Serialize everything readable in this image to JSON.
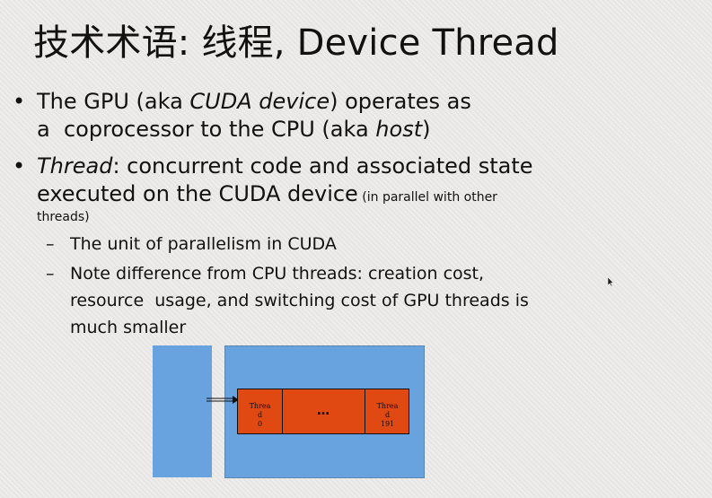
{
  "slide": {
    "title": "技术术语: 线程, Device Thread",
    "bullets": [
      {
        "line1_pre": "The GPU (aka ",
        "line1_italic": "CUDA device",
        "line1_post": ") operates as",
        "line2_pre": "a  coprocessor to the CPU (aka ",
        "line2_italic": "host",
        "line2_post": ")"
      },
      {
        "line1_italic": "Thread",
        "line1_post": ": concurrent code and associated state",
        "line2": "executed on the CUDA device",
        "line2_small": " (in parallel with other",
        "line3_small": "threads)",
        "subitems": [
          {
            "dash": "–",
            "lines": [
              "The unit of parallelism in CUDA"
            ]
          },
          {
            "dash": "–",
            "lines": [
              "Note difference from CPU threads: creation cost,",
              "resource  usage, and switching cost of GPU threads is",
              "much smaller"
            ]
          }
        ]
      }
    ],
    "diagram": {
      "first_cell": [
        "Threa",
        "d",
        "0"
      ],
      "middle_cell": "…",
      "last_cell": [
        "Threa",
        "d",
        "191"
      ]
    },
    "colors": {
      "background": "#ebe9e7",
      "block_blue": "#68a3df",
      "thread_orange": "#e04a12"
    }
  }
}
